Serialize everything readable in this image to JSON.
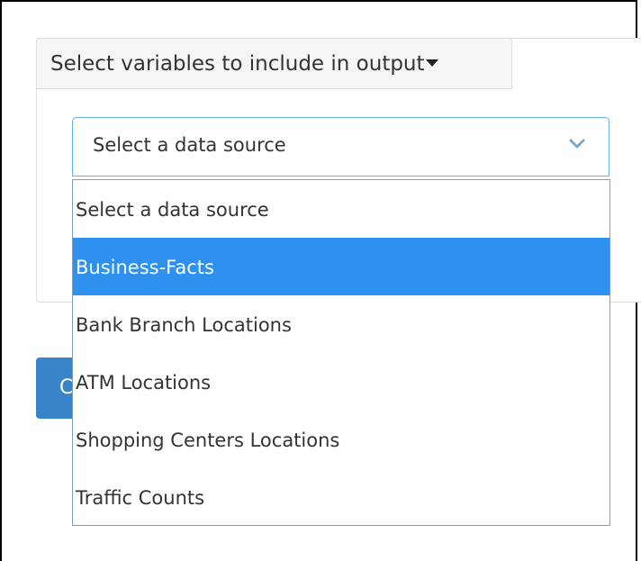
{
  "panel": {
    "toggle_label": "Select variables to include in output"
  },
  "data_source_select": {
    "selected_value": "Select a data source",
    "options": [
      "Select a data source",
      "Business-Facts",
      "Bank Branch Locations",
      "ATM Locations",
      "Shopping Centers Locations",
      "Traffic Counts"
    ],
    "highlighted_option": "Business-Facts"
  },
  "background_button": {
    "label_fragment": "C"
  },
  "colors": {
    "highlight": "#2e91f0",
    "focus_border": "#66afe9",
    "button": "#3a84c9"
  }
}
